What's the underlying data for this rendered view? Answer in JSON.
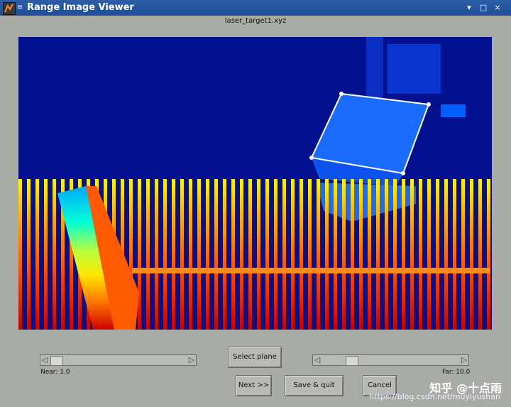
{
  "window": {
    "title": "Range Image Viewer",
    "title_icons": {
      "app": "matlab-icon",
      "menu": "window-menu-icon"
    },
    "controls": [
      "minimize-icon",
      "maximize-icon",
      "close-icon"
    ]
  },
  "viewer": {
    "filename": "laser_target1.xyz",
    "colormap": "jet",
    "selection_color": "#ffffff"
  },
  "sliders": {
    "near": {
      "label": "Near: 1.0",
      "value_fraction": 0.06
    },
    "far": {
      "label": "Far: 10.0",
      "value_fraction": 0.27
    }
  },
  "buttons": {
    "select_plane": "Select plane",
    "next": "Next >>",
    "save_quit": "Save & quit",
    "cancel": "Cancel"
  },
  "watermark": {
    "line1": "知乎 @十点雨",
    "line2": "https://blog.csdn.net/muyiyushan"
  },
  "colors": {
    "titlebar": "#2f5ea8",
    "panel_bg": "#04118f",
    "window_bg": "#a8aba6"
  }
}
